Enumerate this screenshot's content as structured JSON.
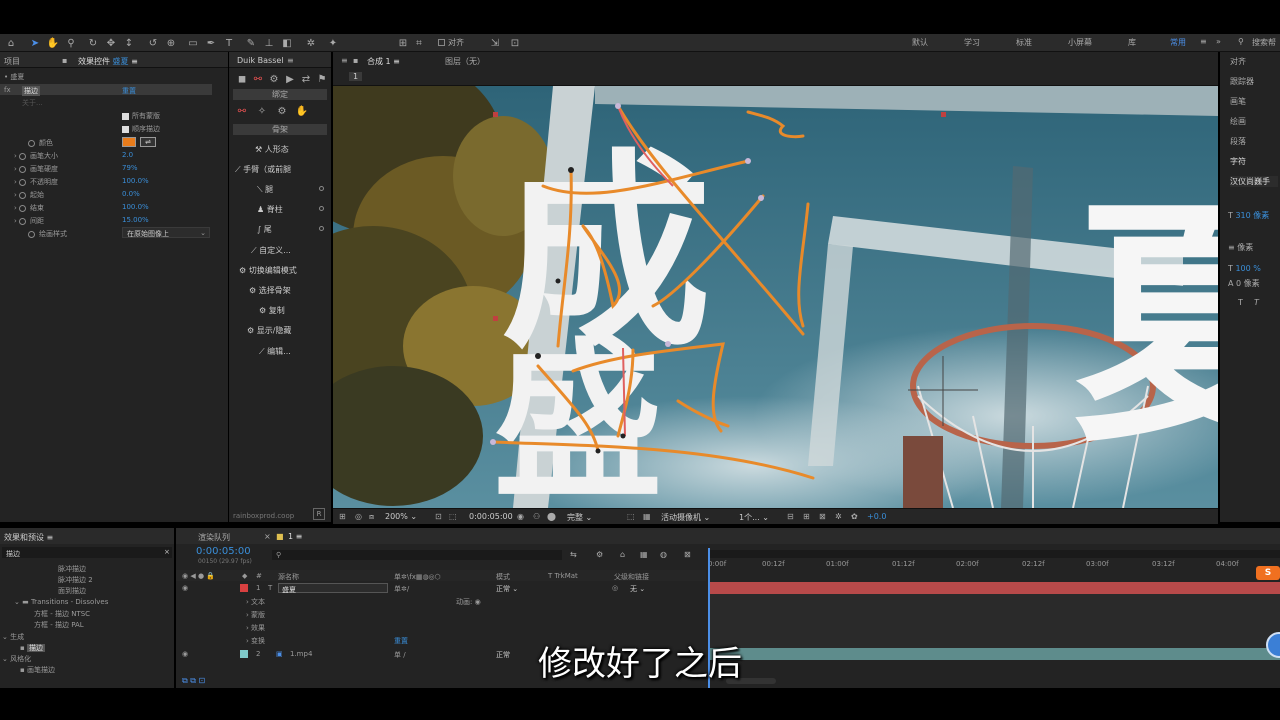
{
  "toolbar": {
    "align_label": "对齐",
    "workspaces": [
      "默认",
      "学习",
      "标准",
      "小屏幕",
      "库",
      "常用"
    ],
    "more": "»",
    "search_placeholder": "搜索帮"
  },
  "project_panel": {
    "tab_project": "项目",
    "tab_effects": "效果控件",
    "layer_name": "盛夏",
    "breadcrumb": "• 盛夏",
    "effect_name": "描边",
    "reset": "重置",
    "about": "关于...",
    "all_masks": "所有蒙版",
    "sequential": "顺序描边",
    "props": [
      {
        "label": "颜色",
        "value": ""
      },
      {
        "label": "画笔大小",
        "value": "2.0"
      },
      {
        "label": "画笔硬度",
        "value": "79%"
      },
      {
        "label": "不透明度",
        "value": "100.0%"
      },
      {
        "label": "起始",
        "value": "0.0%"
      },
      {
        "label": "结束",
        "value": "100.0%"
      },
      {
        "label": "间距",
        "value": "15.00%"
      },
      {
        "label": "绘画样式",
        "value": "在原始图像上"
      }
    ],
    "stroke_color": "#e87c1c"
  },
  "duik": {
    "title": "Duik Bassel",
    "bind": "绑定",
    "bones": "骨架",
    "items": [
      "人形态",
      "手臂（或前腿",
      "腿",
      "脊柱",
      "尾",
      "自定义...",
      "切换编辑模式",
      "选择骨架",
      "复制",
      "显示/隐藏",
      "编辑..."
    ],
    "footer": "rainboxprod.coop",
    "footer_btn": "R"
  },
  "composition": {
    "tab_label": "合成",
    "comp_name": "1",
    "layer_label": "图层（无）",
    "zoom": "200%",
    "timecode": "0:00:05:00",
    "quality": "完整",
    "camera": "活动摄像机",
    "views": "1个...",
    "exposure": "+0.0"
  },
  "effects_presets": {
    "title": "效果和预设",
    "search_value": "描边",
    "items": [
      "脉冲描边",
      "脉冲描边 2",
      "面到描边",
      "Transitions - Dissolves",
      "方框 - 描边 NTSC",
      "方框 - 描边 PAL",
      "生成",
      "描边",
      "风格化",
      "画笔描边"
    ]
  },
  "timeline": {
    "tab_render": "渲染队列",
    "tab_comp": "1",
    "timecode": "0:00:05:00",
    "frame_info": "00150 (29.97 fps)",
    "col_source": "源名称",
    "col_mode": "模式",
    "col_trkmat": "TrkMat",
    "col_parent": "父级和链接",
    "layers": [
      {
        "num": "1",
        "name": "盛夏",
        "mode": "正常",
        "parent": "无",
        "color": "#d84040"
      },
      {
        "num": "2",
        "name": "1.mp4",
        "mode": "正常",
        "parent": "",
        "color": "#7fc9c9"
      }
    ],
    "sub_items": [
      "文本",
      "蒙版",
      "效果",
      "变换"
    ],
    "animate": "动画:",
    "reset": "重置",
    "ruler": [
      "0:00f",
      "00:12f",
      "01:00f",
      "01:12f",
      "02:00f",
      "02:12f",
      "03:00f",
      "03:12f",
      "04:00f"
    ]
  },
  "right_panel": {
    "items": [
      "对齐",
      "跟踪器",
      "画笔",
      "绘画",
      "段落",
      "字符"
    ],
    "font": "汉仪尚巍手",
    "size": "310 像素",
    "tracking": "像素",
    "scale": "100 %",
    "baseline": "0 像素"
  },
  "canvas_text": {
    "char1": "成",
    "char2": "盛",
    "char3": "夏"
  },
  "subtitle": "修改好了之后"
}
